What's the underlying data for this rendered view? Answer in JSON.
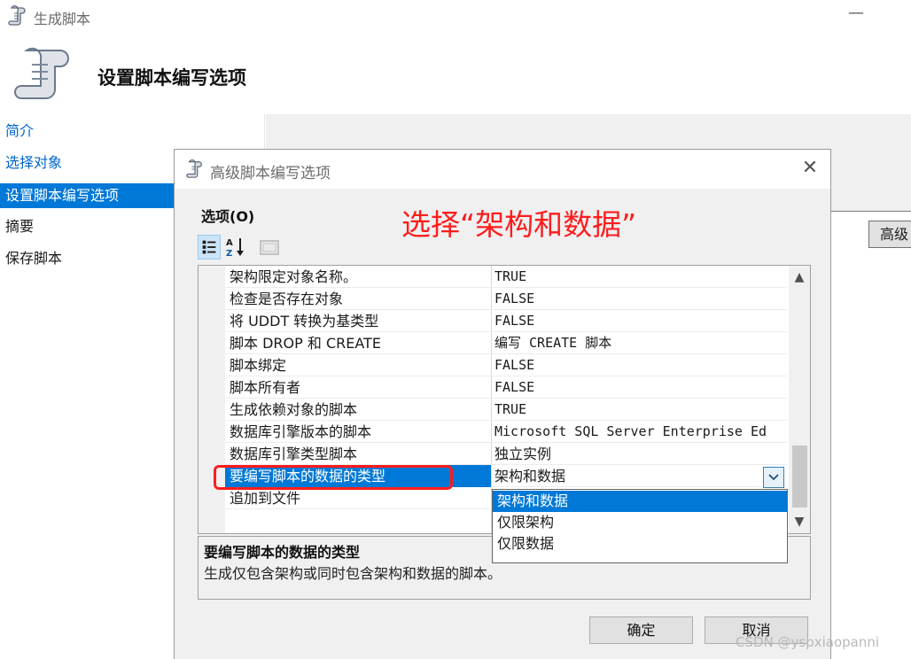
{
  "window": {
    "title": "生成脚本",
    "minimize_glyph": "—"
  },
  "header": {
    "title": "设置脚本编写选项"
  },
  "nav": {
    "items": [
      {
        "label": "简介",
        "state": "link"
      },
      {
        "label": "选择对象",
        "state": "link"
      },
      {
        "label": "设置脚本编写选项",
        "state": "active"
      },
      {
        "label": "摘要",
        "state": "normal"
      },
      {
        "label": "保存脚本",
        "state": "normal"
      }
    ]
  },
  "main": {
    "advanced_label": "高级"
  },
  "dialog": {
    "title": "高级脚本编写选项",
    "close_glyph": "✕",
    "options_label": "选项(O)",
    "annotation": "选择“架构和数据”",
    "rows": [
      {
        "key": "架构限定对象名称。",
        "value": "TRUE"
      },
      {
        "key": "检查是否存在对象",
        "value": "FALSE"
      },
      {
        "key": "将 UDDT 转换为基类型",
        "value": "FALSE"
      },
      {
        "key": "脚本 DROP 和 CREATE",
        "value": "编写 CREATE 脚本"
      },
      {
        "key": "脚本绑定",
        "value": "FALSE"
      },
      {
        "key": "脚本所有者",
        "value": "FALSE"
      },
      {
        "key": "生成依赖对象的脚本",
        "value": "TRUE"
      },
      {
        "key": "数据库引擎版本的脚本",
        "value": "Microsoft SQL Server Enterprise Ed"
      },
      {
        "key": "数据库引擎类型脚本",
        "value": "独立实例"
      },
      {
        "key": "要编写脚本的数据的类型",
        "value": "架构和数据"
      },
      {
        "key": "追加到文件",
        "value": ""
      }
    ],
    "dropdown": {
      "options": [
        "架构和数据",
        "仅限架构",
        "仅限数据"
      ],
      "selected_index": 0
    },
    "description": {
      "title": "要编写脚本的数据的类型",
      "body": "生成仅包含架构或同时包含架构和数据的脚本。"
    },
    "ok_label": "确定",
    "cancel_label": "取消"
  },
  "watermark": "CSDN @yspxiaopanni",
  "colors": {
    "accent": "#0078d7",
    "annotation": "#ff1c1c",
    "link": "#0066cc"
  }
}
